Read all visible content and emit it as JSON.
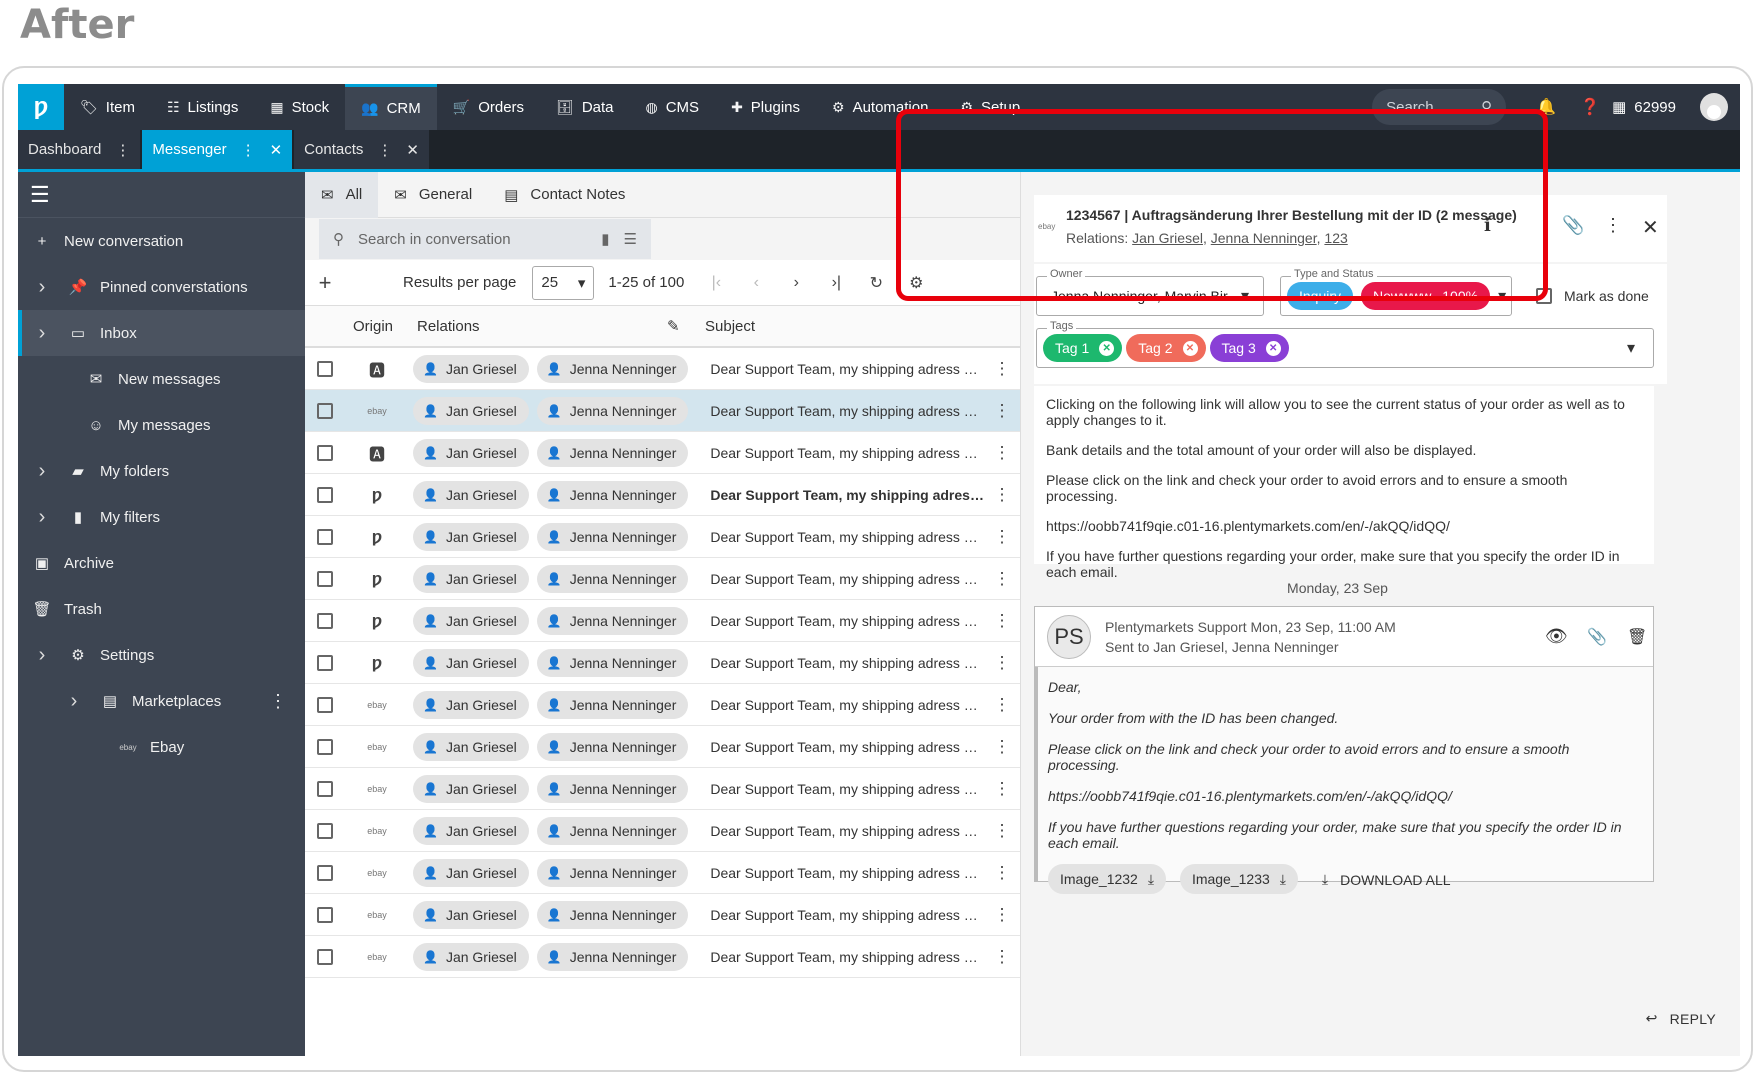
{
  "overlay_title": "After",
  "topnav": {
    "items": [
      {
        "icon": "tag-icon",
        "glyph": "🏷",
        "label": "Item"
      },
      {
        "icon": "listings-icon",
        "glyph": "☷",
        "label": "Listings"
      },
      {
        "icon": "stock-icon",
        "glyph": "▦",
        "label": "Stock"
      },
      {
        "icon": "crm-icon",
        "glyph": "👥",
        "label": "CRM"
      },
      {
        "icon": "cart-icon",
        "glyph": "🛒",
        "label": "Orders"
      },
      {
        "icon": "database-icon",
        "glyph": "🗄",
        "label": "Data"
      },
      {
        "icon": "cms-icon",
        "glyph": "◍",
        "label": "CMS"
      },
      {
        "icon": "puzzle-icon",
        "glyph": "✚",
        "label": "Plugins"
      },
      {
        "icon": "automation-icon",
        "glyph": "⚙",
        "label": "Automation"
      },
      {
        "icon": "gear-icon",
        "glyph": "⚙",
        "label": "Setup"
      }
    ],
    "search_placeholder": "Search",
    "account_id": "62999"
  },
  "tabs": [
    {
      "label": "Dashboard",
      "active": false
    },
    {
      "label": "Messenger",
      "active": true
    },
    {
      "label": "Contacts",
      "active": false
    }
  ],
  "sidebar": {
    "items": [
      {
        "label": "New conversation",
        "icon": "plus-icon",
        "glyph": "+",
        "chevron": false,
        "indent": 0
      },
      {
        "label": "Pinned converstations",
        "icon": "pin-icon",
        "glyph": "📌",
        "chevron": true,
        "indent": 0
      },
      {
        "label": "Inbox",
        "icon": "inbox-icon",
        "glyph": "▭",
        "chevron": true,
        "indent": 0,
        "active": true
      },
      {
        "label": "New messages",
        "icon": "message-icon",
        "glyph": "✉",
        "chevron": false,
        "indent": 1
      },
      {
        "label": "My messages",
        "icon": "person-message-icon",
        "glyph": "☺",
        "chevron": false,
        "indent": 1
      },
      {
        "label": "My folders",
        "icon": "folder-icon",
        "glyph": "▰",
        "chevron": true,
        "indent": 0
      },
      {
        "label": "My filters",
        "icon": "filter-bookmark-icon",
        "glyph": "▮",
        "chevron": true,
        "indent": 0
      },
      {
        "label": "Archive",
        "icon": "archive-icon",
        "glyph": "▣",
        "chevron": false,
        "indent": 0
      },
      {
        "label": "Trash",
        "icon": "trash-icon",
        "glyph": "🗑",
        "chevron": false,
        "indent": 0
      },
      {
        "label": "Settings",
        "icon": "gear-icon",
        "glyph": "⚙",
        "chevron": true,
        "indent": 0
      },
      {
        "label": "Marketplaces",
        "icon": "store-icon",
        "glyph": "▤",
        "chevron": true,
        "indent": 1,
        "menu": true
      },
      {
        "label": "Ebay",
        "icon": "ebay-icon",
        "glyph": "ebay",
        "chevron": false,
        "indent": 2
      }
    ]
  },
  "list": {
    "subtabs": [
      {
        "label": "All",
        "icon": "mail-icon",
        "active": true
      },
      {
        "label": "General",
        "icon": "mail-icon",
        "active": false
      },
      {
        "label": "Contact Notes",
        "icon": "note-icon",
        "active": false
      }
    ],
    "search_placeholder": "Search in conversation",
    "results_per_page_label": "Results per page",
    "results_per_page": "25",
    "range": "1-25 of 100",
    "columns": {
      "origin": "Origin",
      "relations": "Relations",
      "subject": "Subject"
    },
    "rows": [
      {
        "origin": "amazon",
        "r1": "Jan Griesel",
        "r2": "Jenna Nenninger",
        "subject": "Dear Support Team, my shipping adress has changed",
        "selected": false,
        "bold": false
      },
      {
        "origin": "ebay",
        "r1": "Jan Griesel",
        "r2": "Jenna Nenninger",
        "subject": "Dear Support Team, my shipping adress has changed",
        "selected": true,
        "bold": false
      },
      {
        "origin": "amazon",
        "r1": "Jan Griesel",
        "r2": "Jenna Nenninger",
        "subject": "Dear Support Team, my shipping adress has changed",
        "selected": false,
        "bold": false
      },
      {
        "origin": "plenty",
        "r1": "Jan Griesel",
        "r2": "Jenna Nenninger",
        "subject": "Dear Support Team, my shipping adress has changed",
        "selected": false,
        "bold": true
      },
      {
        "origin": "plenty",
        "r1": "Jan Griesel",
        "r2": "Jenna Nenninger",
        "subject": "Dear Support Team, my shipping adress has changed",
        "selected": false,
        "bold": false
      },
      {
        "origin": "plenty",
        "r1": "Jan Griesel",
        "r2": "Jenna Nenninger",
        "subject": "Dear Support Team, my shipping adress has changed",
        "selected": false,
        "bold": false
      },
      {
        "origin": "plenty",
        "r1": "Jan Griesel",
        "r2": "Jenna Nenninger",
        "subject": "Dear Support Team, my shipping adress has changed",
        "selected": false,
        "bold": false
      },
      {
        "origin": "plenty",
        "r1": "Jan Griesel",
        "r2": "Jenna Nenninger",
        "subject": "Dear Support Team, my shipping adress has changed",
        "selected": false,
        "bold": false
      },
      {
        "origin": "ebay",
        "r1": "Jan Griesel",
        "r2": "Jenna Nenninger",
        "subject": "Dear Support Team, my shipping adress has changed",
        "selected": false,
        "bold": false
      },
      {
        "origin": "ebay",
        "r1": "Jan Griesel",
        "r2": "Jenna Nenninger",
        "subject": "Dear Support Team, my shipping adress has changed",
        "selected": false,
        "bold": false
      },
      {
        "origin": "ebay",
        "r1": "Jan Griesel",
        "r2": "Jenna Nenninger",
        "subject": "Dear Support Team, my shipping adress has changed",
        "selected": false,
        "bold": false
      },
      {
        "origin": "ebay",
        "r1": "Jan Griesel",
        "r2": "Jenna Nenninger",
        "subject": "Dear Support Team, my shipping adress has changed",
        "selected": false,
        "bold": false
      },
      {
        "origin": "ebay",
        "r1": "Jan Griesel",
        "r2": "Jenna Nenninger",
        "subject": "Dear Support Team, my shipping adress has changed",
        "selected": false,
        "bold": false
      },
      {
        "origin": "ebay",
        "r1": "Jan Griesel",
        "r2": "Jenna Nenninger",
        "subject": "Dear Support Team, my shipping adress has changed",
        "selected": false,
        "bold": false
      },
      {
        "origin": "ebay",
        "r1": "Jan Griesel",
        "r2": "Jenna Nenninger",
        "subject": "Dear Support Team, my shipping adress has changed",
        "selected": false,
        "bold": false
      }
    ]
  },
  "detail": {
    "title": "1234567 | Auftragsänderung Ihrer Bestellung mit der ID (2 message)",
    "relations_label": "Relations:",
    "relations": [
      "Jan Griesel",
      "Jenna Nenninger",
      "123"
    ],
    "owner_legend": "Owner",
    "owner_value": "Jenna Nenninger, Marvin Bir...",
    "type_legend": "Type and Status",
    "type_value": "Inquiry",
    "status_value": "Newwww...100%",
    "mark_done": "Mark as done",
    "tags_legend": "Tags",
    "tags": [
      {
        "label": "Tag 1",
        "color": "#1db86e"
      },
      {
        "label": "Tag 2",
        "color": "#f06b5b"
      },
      {
        "label": "Tag 3",
        "color": "#8a3fd6"
      }
    ],
    "body": [
      "Clicking on the following link will allow you to see the current status of your order as well as to apply changes to it.",
      "Bank details and the total amount of your order will also be displayed.",
      "Please click on the link and check your order to avoid errors and to ensure a smooth processing.",
      "https://oobb741f9qie.c01-16.plentymarkets.com/en/-/akQQ/idQQ/",
      "If you have further questions regarding your order, make sure that you specify the order ID in each email."
    ],
    "date_divider": "Monday, 23 Sep",
    "message": {
      "initials": "PS",
      "sender": "Plentymarkets Support",
      "time": "Mon, 23 Sep, 11:00 AM",
      "sent_to": "Sent to Jan Griesel, Jenna Nenninger",
      "lines": [
        "Dear,",
        "Your order from with the ID has been changed.",
        "Please click on the link and check your order to avoid errors and to ensure a smooth processing.",
        "https://oobb741f9qie.c01-16.plentymarkets.com/en/-/akQQ/idQQ/",
        "If you have further questions regarding your order, make sure that you specify the order ID in each email."
      ],
      "attachments": [
        "Image_1232",
        "Image_1233"
      ],
      "download_all": "DOWNLOAD ALL"
    },
    "reply": "REPLY"
  },
  "colors": {
    "brand": "#00a1d6",
    "highlight": "#e8000b",
    "inquiry": "#3daee9",
    "status": "#e8184a"
  }
}
